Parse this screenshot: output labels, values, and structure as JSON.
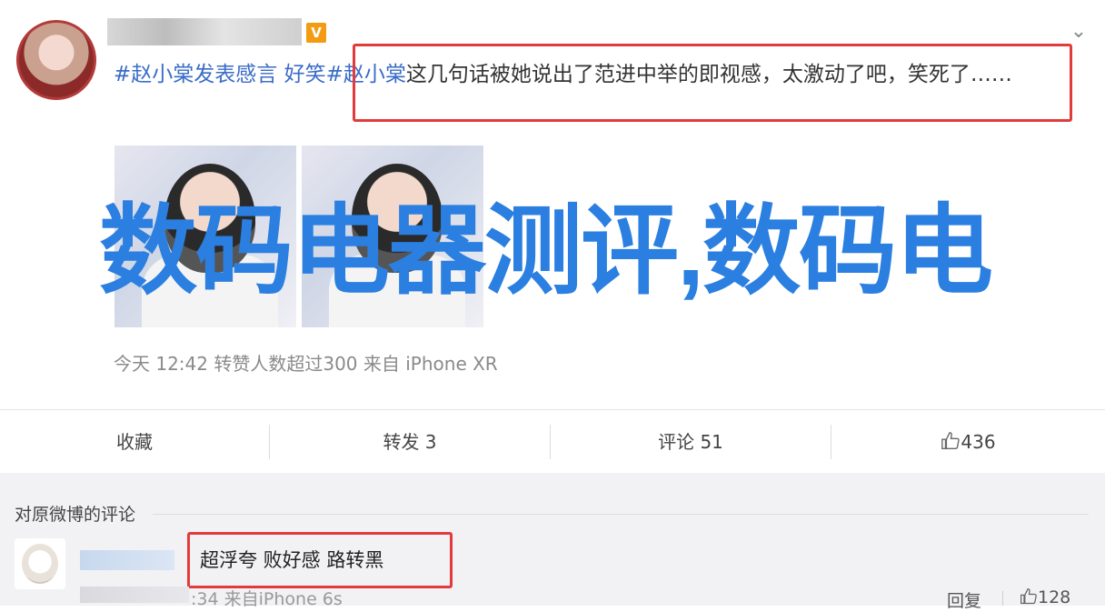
{
  "post": {
    "vip_badge": "V",
    "text_part1": "#赵小棠发表感言 好笑#",
    "text_part2": "赵小棠",
    "text_part3": "这几句话被她说出了范进中举的即视感，太激动了吧，笑死了……",
    "meta": "今天 12:42 转赞人数超过300  来自 iPhone XR",
    "collapse_icon": "chevron-down-icon"
  },
  "overlay": {
    "title": "数码电器测评,数码电"
  },
  "actions": {
    "favorite": "收藏",
    "repost": "转发 3",
    "comment": "评论 51",
    "like_count": "436",
    "like_icon": "thumbs-up-icon"
  },
  "comments": {
    "heading": "对原微博的评论",
    "items": [
      {
        "text": "超浮夸 败好感 路转黑",
        "meta": ":34  来自iPhone 6s",
        "reply": "回复",
        "like_count": "128"
      }
    ]
  },
  "colors": {
    "tag": "#3a6cc7",
    "highlight": "#e23b3b",
    "overlay_title": "#2b7fe0"
  }
}
